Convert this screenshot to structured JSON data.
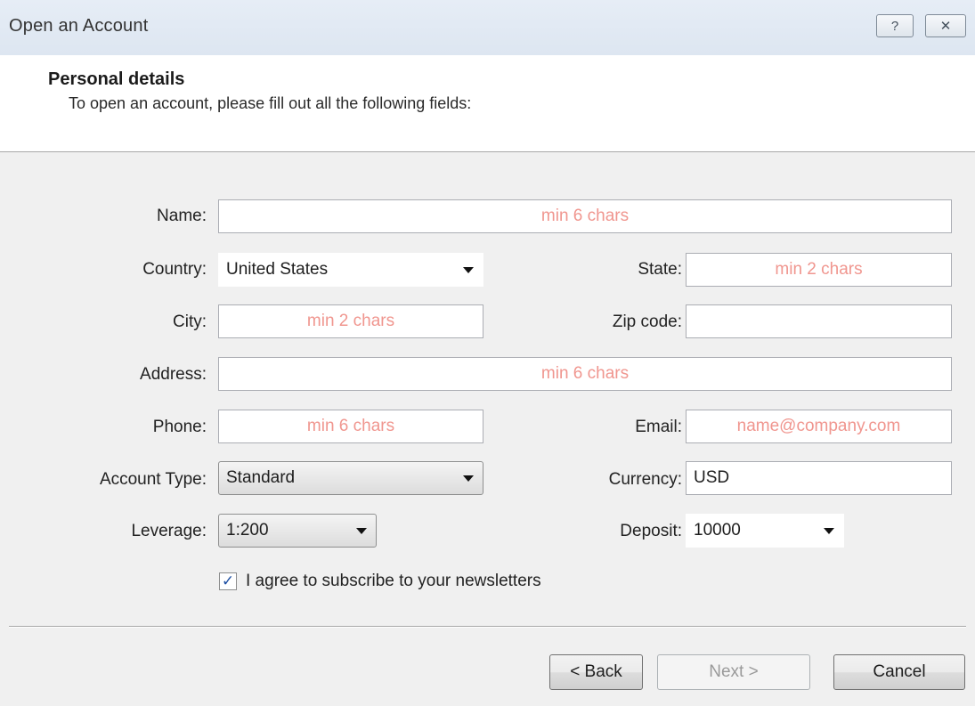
{
  "window": {
    "title": "Open an Account",
    "help_glyph": "?",
    "close_glyph": "✕"
  },
  "header": {
    "title": "Personal details",
    "subtitle": "To open an account, please fill out all the following fields:"
  },
  "form": {
    "name": {
      "label": "Name:",
      "placeholder": "min 6 chars",
      "value": ""
    },
    "country": {
      "label": "Country:",
      "value": "United States"
    },
    "state": {
      "label": "State:",
      "placeholder": "min 2 chars",
      "value": ""
    },
    "city": {
      "label": "City:",
      "placeholder": "min 2 chars",
      "value": ""
    },
    "zip": {
      "label": "Zip code:",
      "placeholder": "",
      "value": ""
    },
    "address": {
      "label": "Address:",
      "placeholder": "min 6 chars",
      "value": ""
    },
    "phone": {
      "label": "Phone:",
      "placeholder": "min 6 chars",
      "value": ""
    },
    "email": {
      "label": "Email:",
      "placeholder": "name@company.com",
      "value": ""
    },
    "account_type": {
      "label": "Account Type:",
      "value": "Standard"
    },
    "currency": {
      "label": "Currency:",
      "value": "USD"
    },
    "leverage": {
      "label": "Leverage:",
      "value": "1:200"
    },
    "deposit": {
      "label": "Deposit:",
      "value": "10000"
    },
    "newsletter": {
      "label": "I agree to subscribe to your newsletters",
      "checked": true,
      "check_glyph": "✓"
    }
  },
  "buttons": {
    "back": "< Back",
    "next": "Next >",
    "cancel": "Cancel"
  },
  "colors": {
    "placeholder": "#f0968f",
    "accent": "#1d4fa3"
  }
}
